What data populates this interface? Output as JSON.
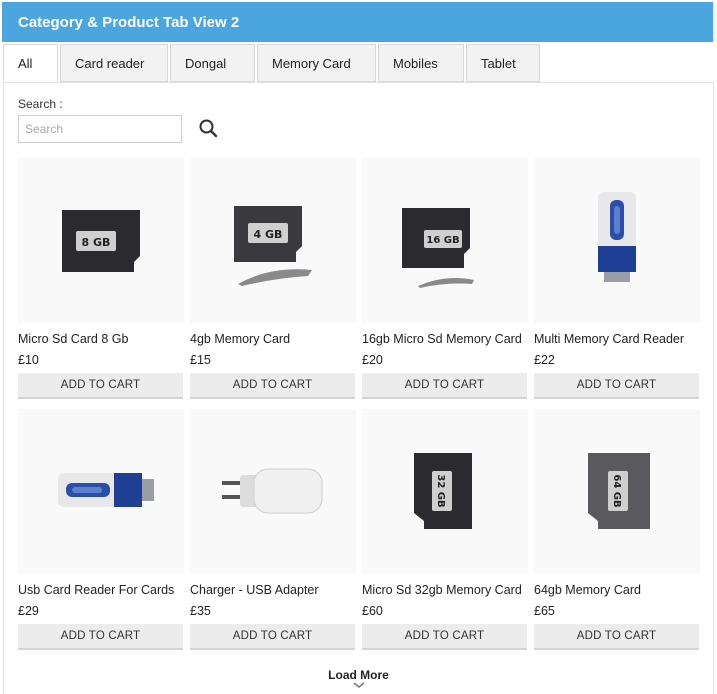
{
  "header": {
    "title": "Category & Product Tab View 2"
  },
  "tabs": [
    {
      "label": "All",
      "active": true
    },
    {
      "label": "Card reader",
      "active": false
    },
    {
      "label": "Dongal",
      "active": false
    },
    {
      "label": "Memory Card",
      "active": false
    },
    {
      "label": "Mobiles",
      "active": false
    },
    {
      "label": "Tablet",
      "active": false
    }
  ],
  "search": {
    "label": "Search :",
    "placeholder": "Search",
    "value": "",
    "icon": "search-icon"
  },
  "add_to_cart_label": "ADD TO CART",
  "products": [
    {
      "name": "Micro Sd Card 8 Gb",
      "price": "£10",
      "image": "sd-card-8gb",
      "card_text": "8 GB"
    },
    {
      "name": "4gb Memory Card",
      "price": "£15",
      "image": "memory-card-4gb",
      "card_text": "4 GB"
    },
    {
      "name": "16gb Micro Sd Memory Card",
      "price": "£20",
      "image": "micro-sd-16gb",
      "card_text": "16 GB"
    },
    {
      "name": "Multi Memory Card Reader",
      "price": "£22",
      "image": "usb-card-reader",
      "card_text": ""
    },
    {
      "name": "Usb Card Reader For Cards",
      "price": "£29",
      "image": "usb-card-reader-lying",
      "card_text": ""
    },
    {
      "name": "Charger - USB Adapter",
      "price": "£35",
      "image": "usb-charger",
      "card_text": ""
    },
    {
      "name": "Micro Sd 32gb Memory Card",
      "price": "£60",
      "image": "micro-sd-32gb",
      "card_text": "32 GB"
    },
    {
      "name": "64gb Memory Card",
      "price": "£65",
      "image": "memory-card-64gb",
      "card_text": "64 GB"
    }
  ],
  "load_more": {
    "label": "Load More",
    "icon": "chevron-down-icon"
  },
  "colors": {
    "header_bg": "#4ba5df",
    "button_bg": "#ececec"
  }
}
